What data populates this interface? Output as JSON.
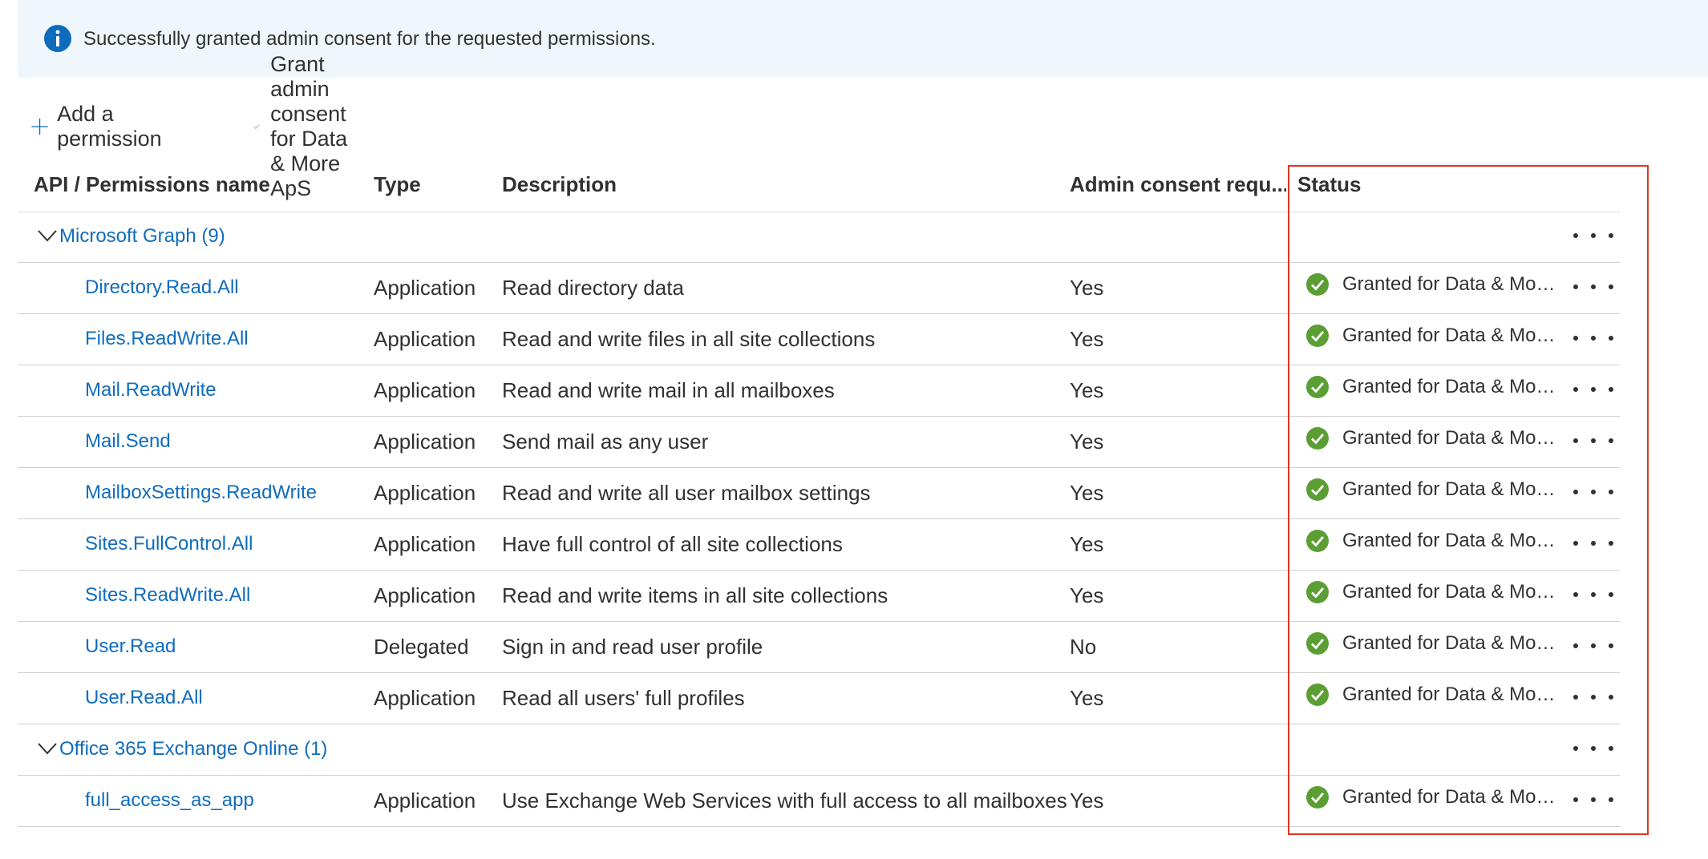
{
  "banner": {
    "message": "Successfully granted admin consent for the requested permissions.",
    "icon": "info-icon"
  },
  "toolbar": {
    "add_label": "Add a permission",
    "grant_label": "Grant admin consent for Data & More ApS"
  },
  "table": {
    "headers": {
      "name": "API / Permissions name",
      "type": "Type",
      "description": "Description",
      "admin": "Admin consent requ...",
      "status": "Status"
    },
    "groups": [
      {
        "label": "Microsoft Graph (9)",
        "rows": [
          {
            "name": "Directory.Read.All",
            "type": "Application",
            "description": "Read directory data",
            "admin": "Yes",
            "status": "Granted for Data & More ApS"
          },
          {
            "name": "Files.ReadWrite.All",
            "type": "Application",
            "description": "Read and write files in all site collections",
            "admin": "Yes",
            "status": "Granted for Data & More ApS"
          },
          {
            "name": "Mail.ReadWrite",
            "type": "Application",
            "description": "Read and write mail in all mailboxes",
            "admin": "Yes",
            "status": "Granted for Data & More ApS"
          },
          {
            "name": "Mail.Send",
            "type": "Application",
            "description": "Send mail as any user",
            "admin": "Yes",
            "status": "Granted for Data & More ApS"
          },
          {
            "name": "MailboxSettings.ReadWrite",
            "type": "Application",
            "description": "Read and write all user mailbox settings",
            "admin": "Yes",
            "status": "Granted for Data & More ApS"
          },
          {
            "name": "Sites.FullControl.All",
            "type": "Application",
            "description": "Have full control of all site collections",
            "admin": "Yes",
            "status": "Granted for Data & More ApS"
          },
          {
            "name": "Sites.ReadWrite.All",
            "type": "Application",
            "description": "Read and write items in all site collections",
            "admin": "Yes",
            "status": "Granted for Data & More ApS"
          },
          {
            "name": "User.Read",
            "type": "Delegated",
            "description": "Sign in and read user profile",
            "admin": "No",
            "status": "Granted for Data & More ApS"
          },
          {
            "name": "User.Read.All",
            "type": "Application",
            "description": "Read all users' full profiles",
            "admin": "Yes",
            "status": "Granted for Data & More ApS"
          }
        ]
      },
      {
        "label": "Office 365 Exchange Online (1)",
        "rows": [
          {
            "name": "full_access_as_app",
            "type": "Application",
            "description": "Use Exchange Web Services with full access to all mailboxes",
            "admin": "Yes",
            "status": "Granted for Data & More ApS"
          }
        ]
      }
    ]
  },
  "colors": {
    "link": "#0f6cbd",
    "success": "#5b9e34",
    "banner_bg": "#eff6fc",
    "highlight": "#e0361f"
  }
}
